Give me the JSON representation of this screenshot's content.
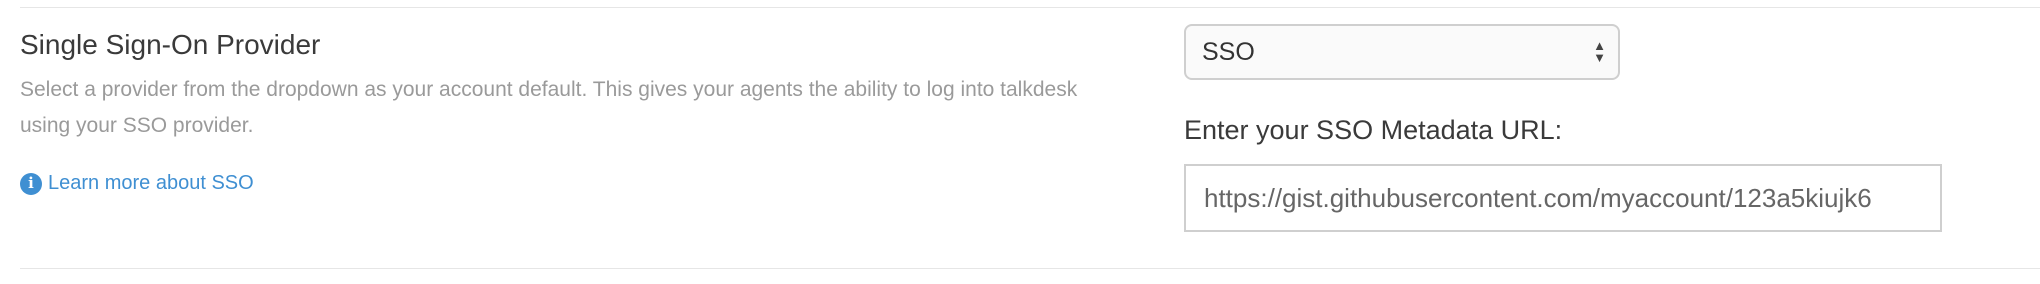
{
  "sso": {
    "title": "Single Sign-On Provider",
    "description": "Select a provider from the dropdown as your account default. This gives your agents the ability to log into talkdesk using your SSO provider.",
    "learn_more": "Learn more about SSO",
    "info_icon": "i",
    "provider_select": {
      "selected": "SSO"
    },
    "metadata_url": {
      "label": "Enter your SSO Metadata URL:",
      "value": "https://gist.githubusercontent.com/myaccount/123a5kiujk6"
    }
  },
  "colors": {
    "link": "#3f8fd2",
    "heading": "#3a3a3a",
    "muted": "#9a9a9a",
    "border": "#cfcfcf"
  }
}
